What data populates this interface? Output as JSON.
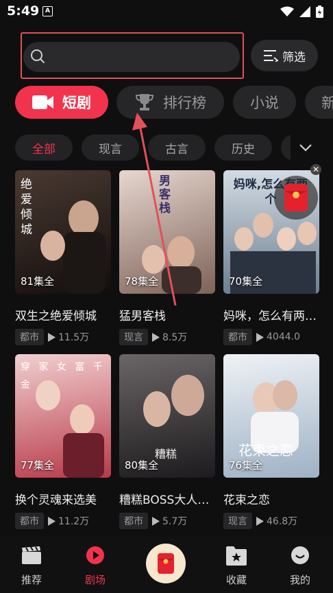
{
  "status": {
    "time": "5:49",
    "notif_letter": "A"
  },
  "search": {
    "placeholder": ""
  },
  "filter": {
    "label": "筛选"
  },
  "categories": [
    {
      "label": "短剧",
      "active": true
    },
    {
      "label": "排行榜"
    },
    {
      "label": "小说"
    },
    {
      "label": "新"
    }
  ],
  "genres": [
    "全部",
    "现言",
    "古言",
    "历史"
  ],
  "cards": [
    {
      "title": "双生之绝爱倾城",
      "episodes": "81集全",
      "tag": "都市",
      "views": "11.5万",
      "poster_text": "绝爱倾城",
      "colors": [
        "#3a2d28",
        "#120d0c"
      ]
    },
    {
      "title": "猛男客栈",
      "episodes": "78集全",
      "tag": "现言",
      "views": "8.5万",
      "poster_text": "男客栈",
      "colors": [
        "#d9c7bd",
        "#7e6258"
      ]
    },
    {
      "title": "妈咪，怎么有两个爹地",
      "episodes": "70集全",
      "tag": "都市",
      "views": "4044.0",
      "poster_text": "妈咪,怎么有两个",
      "colors": [
        "#c9d4dc",
        "#6d7f91"
      ]
    },
    {
      "title": "换个灵魂来选美",
      "episodes": "77集全",
      "tag": "都市",
      "views": "11.2万",
      "poster_text": "穿 家 女 富 千 金",
      "colors": [
        "#e9b6b6",
        "#b83a4a"
      ]
    },
    {
      "title": "糟糕BOSS大人要娶我",
      "episodes": "80集全",
      "tag": "都市",
      "views": "5.7万",
      "poster_text": "糟糕",
      "colors": [
        "#5e5a5c",
        "#1d1b1d"
      ]
    },
    {
      "title": "花束之恋",
      "episodes": "76集全",
      "tag": "现言",
      "views": "46.8万",
      "poster_text": "花束之恋",
      "colors": [
        "#dfe6ee",
        "#9eb1c4"
      ]
    }
  ],
  "nav": [
    {
      "label": "推荐",
      "icon": "clapperboard-icon"
    },
    {
      "label": "剧场",
      "icon": "play-circle-icon",
      "active": true
    },
    {
      "label": "",
      "icon": "red-envelope-icon"
    },
    {
      "label": "收藏",
      "icon": "bookmark-star-icon"
    },
    {
      "label": "我的",
      "icon": "smile-face-icon"
    }
  ]
}
